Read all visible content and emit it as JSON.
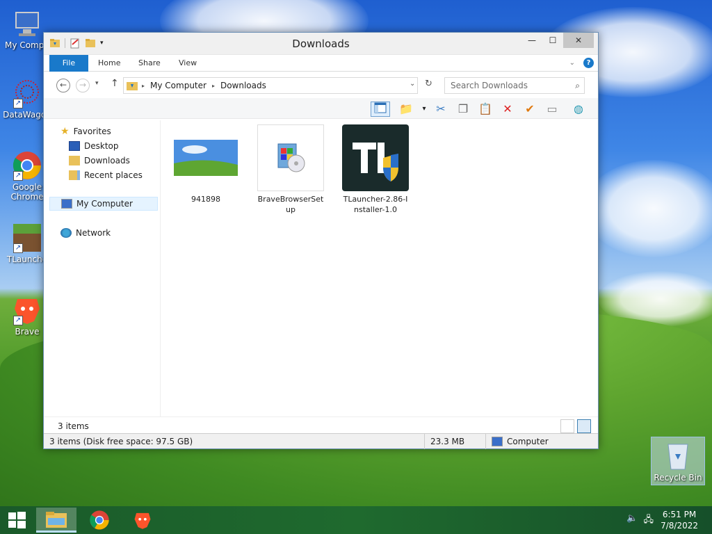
{
  "desktop": {
    "icons": [
      {
        "label": "My Compu"
      },
      {
        "label": "DataWagon"
      },
      {
        "label": "Google Chrome"
      },
      {
        "label": "TLaunche"
      },
      {
        "label": "Brave"
      }
    ],
    "recycle_bin": "Recycle Bin"
  },
  "window": {
    "title": "Downloads",
    "controls": {
      "minimize": "—",
      "maximize": "☐",
      "close": "✕"
    },
    "ribbon": {
      "file": "File",
      "tabs": [
        "Home",
        "Share",
        "View"
      ]
    },
    "address": {
      "crumbs": [
        "My Computer",
        "Downloads"
      ],
      "search_placeholder": "Search Downloads"
    },
    "nav": {
      "favorites": "Favorites",
      "desktop": "Desktop",
      "downloads": "Downloads",
      "recent": "Recent places",
      "my_computer": "My Computer",
      "network": "Network"
    },
    "files": [
      {
        "name": "941898"
      },
      {
        "name_line1": "BraveBrowserSet",
        "name_line2": "up"
      },
      {
        "name_line1": "TLauncher-2.86-I",
        "name_line2": "nstaller-1.0"
      }
    ],
    "item_count": "3 items",
    "status": {
      "left": "3 items (Disk free space: 97.5 GB)",
      "size": "23.3 MB",
      "location": "Computer"
    }
  },
  "taskbar": {
    "time": "6:51 PM",
    "date": "7/8/2022"
  }
}
